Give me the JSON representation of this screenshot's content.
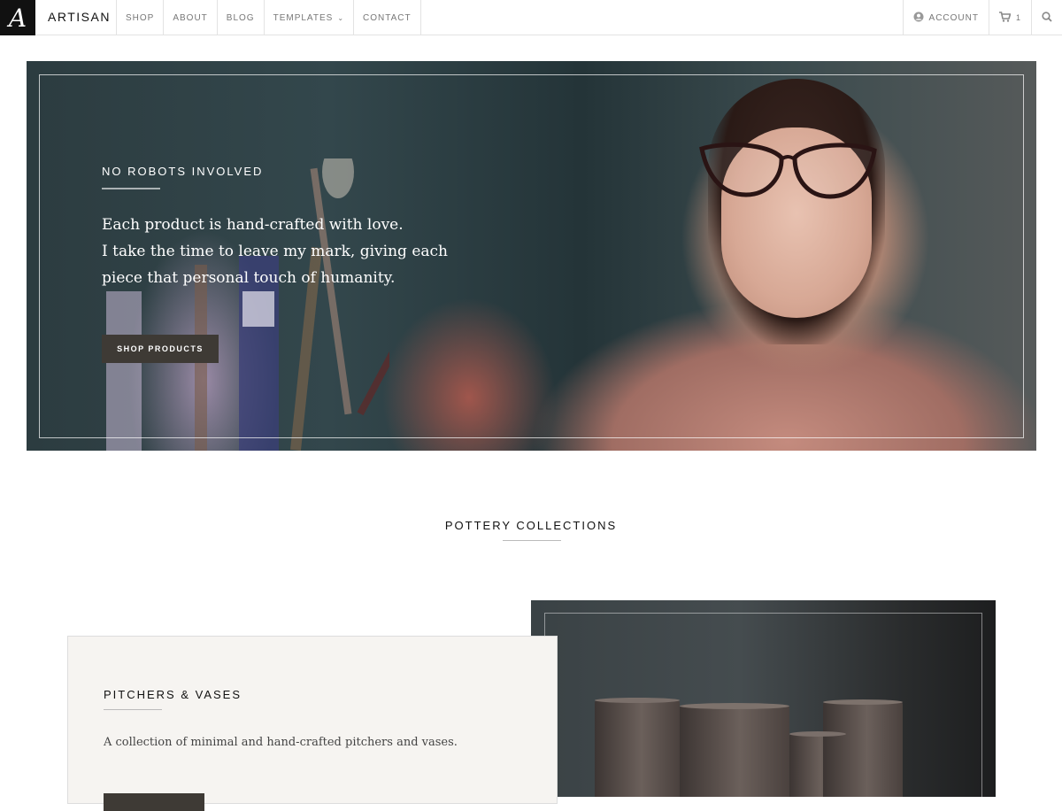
{
  "header": {
    "logo_letter": "A",
    "brand": "ARTISAN",
    "nav": [
      {
        "label": "SHOP"
      },
      {
        "label": "ABOUT"
      },
      {
        "label": "BLOG"
      },
      {
        "label": "TEMPLATES",
        "has_dropdown": true
      },
      {
        "label": "CONTACT"
      }
    ],
    "account_label": "ACCOUNT",
    "cart_count": "1"
  },
  "hero": {
    "eyebrow": "NO ROBOTS INVOLVED",
    "lines": [
      "Each product is hand-crafted with love.",
      "I take the time to leave my mark, giving each",
      "piece that personal touch of humanity."
    ],
    "button_label": "SHOP PRODUCTS"
  },
  "section": {
    "title": "POTTERY COLLECTIONS"
  },
  "collection": {
    "title": "PITCHERS & VASES",
    "description": "A collection of minimal and hand-crafted pitchers and vases."
  },
  "colors": {
    "accent_dark": "#3e3a35",
    "logo_bg": "#111111"
  }
}
